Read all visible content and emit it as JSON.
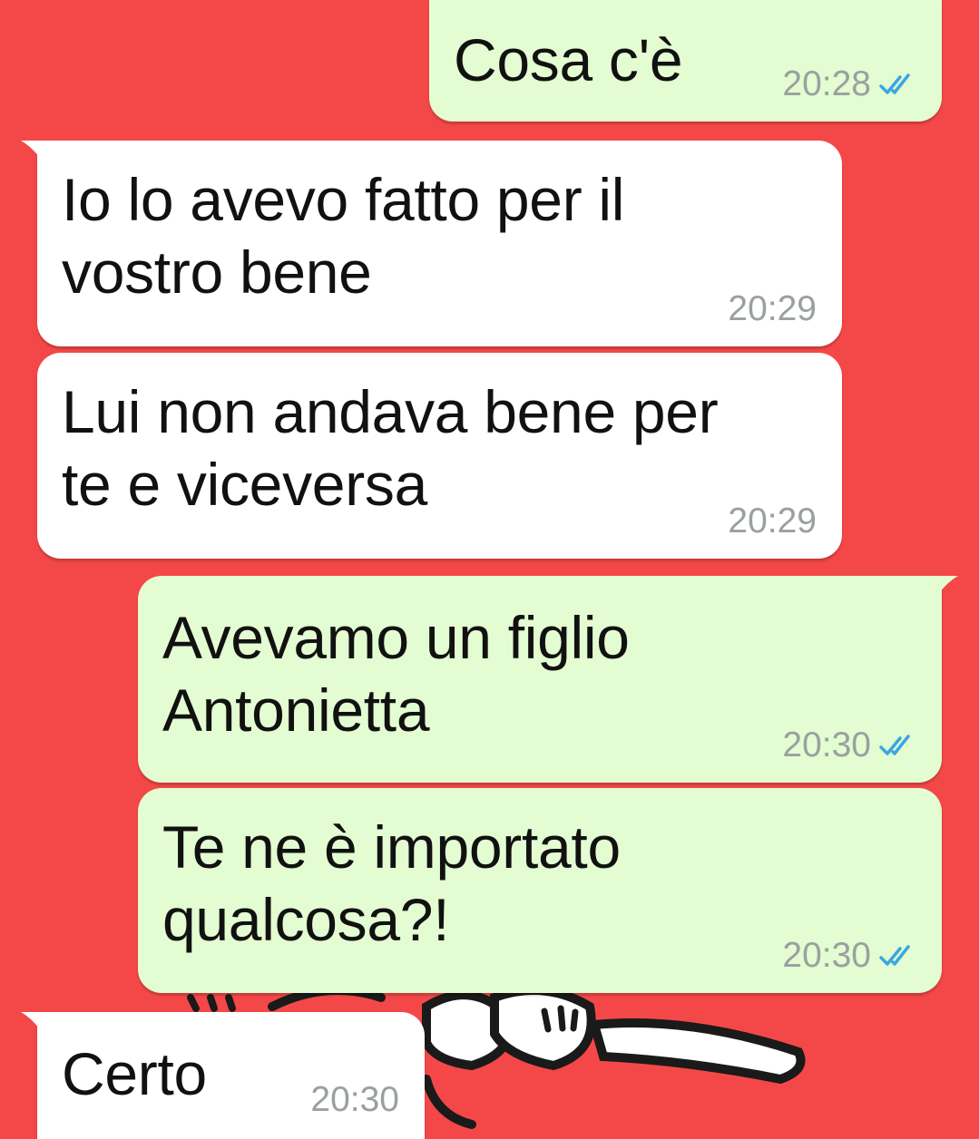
{
  "chat": {
    "messages": [
      {
        "direction": "outgoing",
        "text": "Cosa c'è",
        "time": "20:28",
        "status_icon": "double-check-read-icon"
      },
      {
        "direction": "incoming",
        "text": "Io lo avevo fatto per il\nvostro bene",
        "time": "20:29"
      },
      {
        "direction": "incoming",
        "text": "Lui non andava bene per\nte e viceversa",
        "time": "20:29"
      },
      {
        "direction": "outgoing",
        "text": "Avevamo un figlio\nAntonietta",
        "time": "20:30",
        "status_icon": "double-check-read-icon"
      },
      {
        "direction": "outgoing",
        "text": "Te ne è importato\nqualcosa?!",
        "time": "20:30",
        "status_icon": "double-check-read-icon"
      },
      {
        "direction": "incoming",
        "text": "Certo",
        "time": "20:30"
      }
    ]
  },
  "colors": {
    "wallpaper": "#f44848",
    "incoming_bubble": "#ffffff",
    "outgoing_bubble": "#e3fcd1",
    "timestamp": "#9aa0a0",
    "read_ticks": "#3aa7e0"
  }
}
